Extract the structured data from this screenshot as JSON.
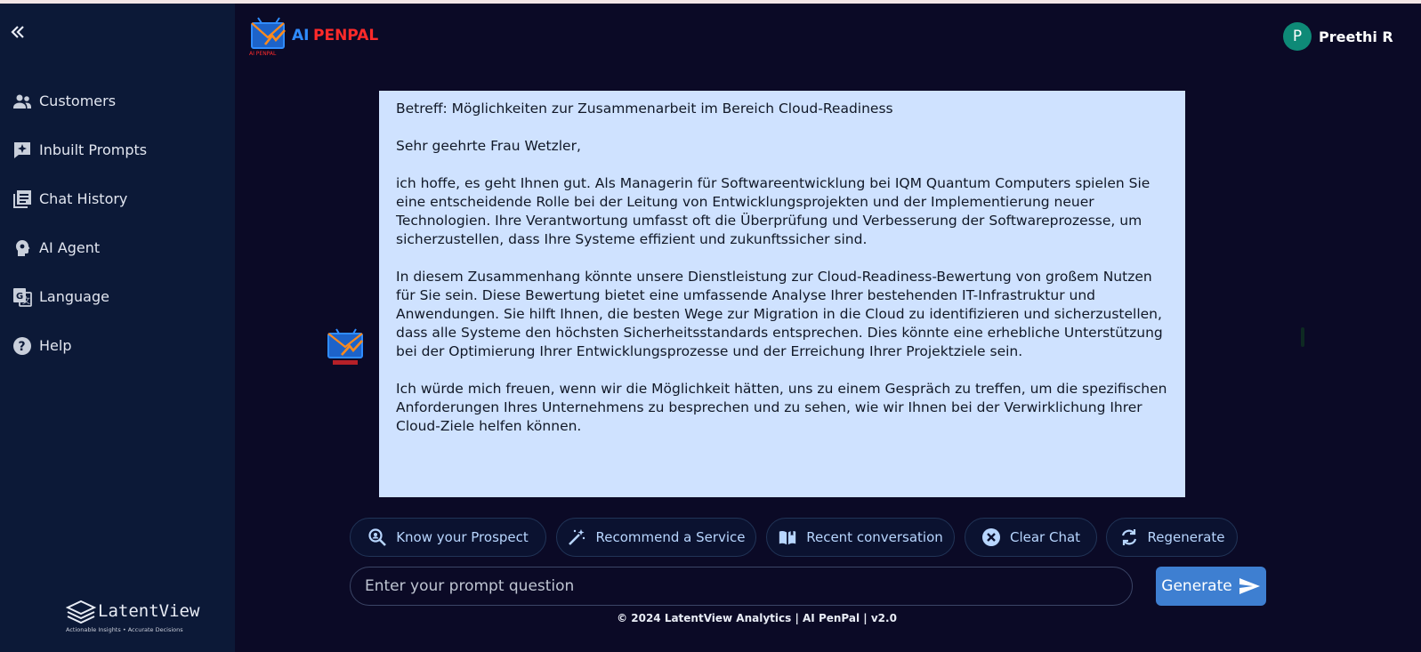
{
  "app": {
    "logo_ai": "AI",
    "logo_penpal": "PENPAL",
    "logo_sub": "AI PENPAL"
  },
  "user": {
    "initial": "P",
    "name": "Preethi R"
  },
  "sidebar": {
    "items": [
      {
        "label": "Customers",
        "icon": "people-icon"
      },
      {
        "label": "Inbuilt Prompts",
        "icon": "prompt-sparkle-icon"
      },
      {
        "label": "Chat History",
        "icon": "library-icon"
      },
      {
        "label": "AI Agent",
        "icon": "agent-head-icon"
      },
      {
        "label": "Language",
        "icon": "translate-icon"
      },
      {
        "label": "Help",
        "icon": "help-icon"
      }
    ],
    "brand": {
      "name": "LatentView",
      "tagline": "Actionable Insights • Accurate Decisions"
    }
  },
  "message": {
    "subject": "Betreff: Möglichkeiten zur Zusammenarbeit im Bereich Cloud-Readiness",
    "greeting": "Sehr geehrte Frau Wetzler,",
    "p1": "ich hoffe, es geht Ihnen gut. Als Managerin für Softwareentwicklung bei IQM Quantum Computers spielen Sie eine entscheidende Rolle bei der Leitung von Entwicklungsprojekten und der Implementierung neuer Technologien. Ihre Verantwortung umfasst oft die Überprüfung und Verbesserung der Softwareprozesse, um sicherzustellen, dass Ihre Systeme effizient und zukunftssicher sind.",
    "p2": "In diesem Zusammenhang könnte unsere Dienstleistung zur Cloud-Readiness-Bewertung von großem Nutzen für Sie sein. Diese Bewertung bietet eine umfassende Analyse Ihrer bestehenden IT-Infrastruktur und Anwendungen. Sie hilft Ihnen, die besten Wege zur Migration in die Cloud zu identifizieren und sicherzustellen, dass alle Systeme den höchsten Sicherheitsstandards entsprechen. Dies könnte eine erhebliche Unterstützung bei der Optimierung Ihrer Entwicklungsprozesse und der Erreichung Ihrer Projektziele sein.",
    "p3": "Ich würde mich freuen, wenn wir die Möglichkeit hätten, uns zu einem Gespräch zu treffen, um die spezifischen Anforderungen Ihres Unternehmens zu besprechen und zu sehen, wie wir Ihnen bei der Verwirklichung Ihrer Cloud-Ziele helfen können."
  },
  "actions": {
    "know": "Know your Prospect",
    "recommend": "Recommend a Service",
    "recent": "Recent conversation",
    "clear": "Clear Chat",
    "regenerate": "Regenerate"
  },
  "prompt": {
    "placeholder": "Enter your prompt question",
    "value": ""
  },
  "generate_label": "Generate",
  "footer": "© 2024 LatentView Analytics | AI PenPal | v2.0",
  "colors": {
    "sidebar": "#0c1937",
    "background": "#0b0a26",
    "message_bg": "#cfe2ff",
    "accent": "#3e7fd1",
    "avatar": "#0e8a77"
  }
}
